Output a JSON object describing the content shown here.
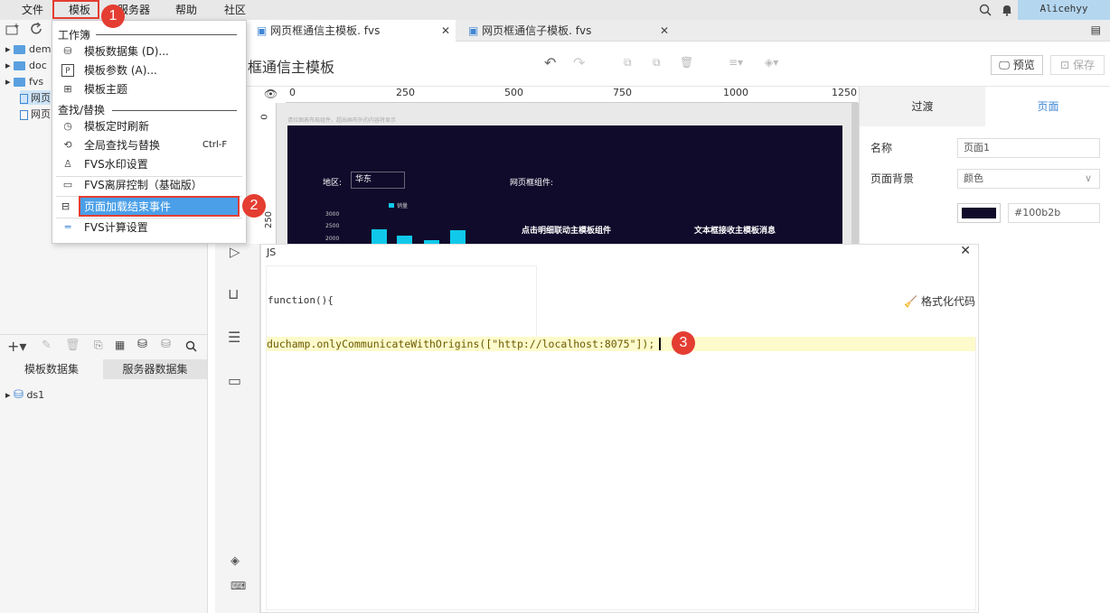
{
  "menubar": {
    "items": [
      "文件",
      "模板",
      "服务器",
      "帮助",
      "社区"
    ],
    "user": "Alicehyy"
  },
  "tabs": [
    {
      "label": "网页框通信主模板. fvs",
      "active": true
    },
    {
      "label": "网页框通信子模板. fvs",
      "active": false
    }
  ],
  "toolbar": {
    "title": "页框通信主模板",
    "preview_label": "预览",
    "save_label": "保存"
  },
  "left_tree": {
    "items": [
      "dem",
      "doc",
      "fvs",
      "网页",
      "网页"
    ]
  },
  "datasets": {
    "tab_template": "模板数据集",
    "tab_server": "服务器数据集",
    "items": [
      "ds1"
    ]
  },
  "dropdown": {
    "group1": "工作簿",
    "items1": [
      "模板数据集 (D)...",
      "模板参数 (A)...",
      "模板主题"
    ],
    "group2": "查找/替换",
    "items2": [
      "模板定时刷新",
      "全局查找与替换",
      "FVS水印设置",
      "FVS离屏控制（基础版）",
      "页面加载结束事件",
      "FVS计算设置"
    ],
    "shortcut_find": "Ctrl-F"
  },
  "ruler": {
    "ticks": [
      "0",
      "250",
      "500",
      "750",
      "1000",
      "1250"
    ],
    "left_ticks": [
      "0",
      "250"
    ]
  },
  "canvas": {
    "hint": "请拉图表布局组件，超出画布外的内容将显示",
    "region_label": "地区:",
    "region_value": "华东",
    "widget_label": "网页框组件:",
    "legend": "销量",
    "y_ticks": [
      "3000",
      "2500",
      "2000"
    ],
    "card1": "点击明细联动主模板组件",
    "card2": "文本框接收主模板消息"
  },
  "rightpanel": {
    "tab_transition": "过渡",
    "tab_page": "页面",
    "name_label": "名称",
    "name_value": "页面1",
    "bg_label": "页面背景",
    "bg_value": "颜色",
    "color_hex": "#100b2b"
  },
  "jsdialog": {
    "title": "JS",
    "function_header": "function(){",
    "format_label": "格式化代码",
    "code": "duchamp.onlyCommunicateWithOrigins([\"http://localhost:8075\"]);"
  },
  "badges": [
    "1",
    "2",
    "3"
  ],
  "colors": {
    "accent": "#3f86d4",
    "highlight": "#4a9fe8",
    "badge": "#e43d32",
    "dashboard_bg": "#100b2b",
    "bar": "#10c9ea"
  }
}
